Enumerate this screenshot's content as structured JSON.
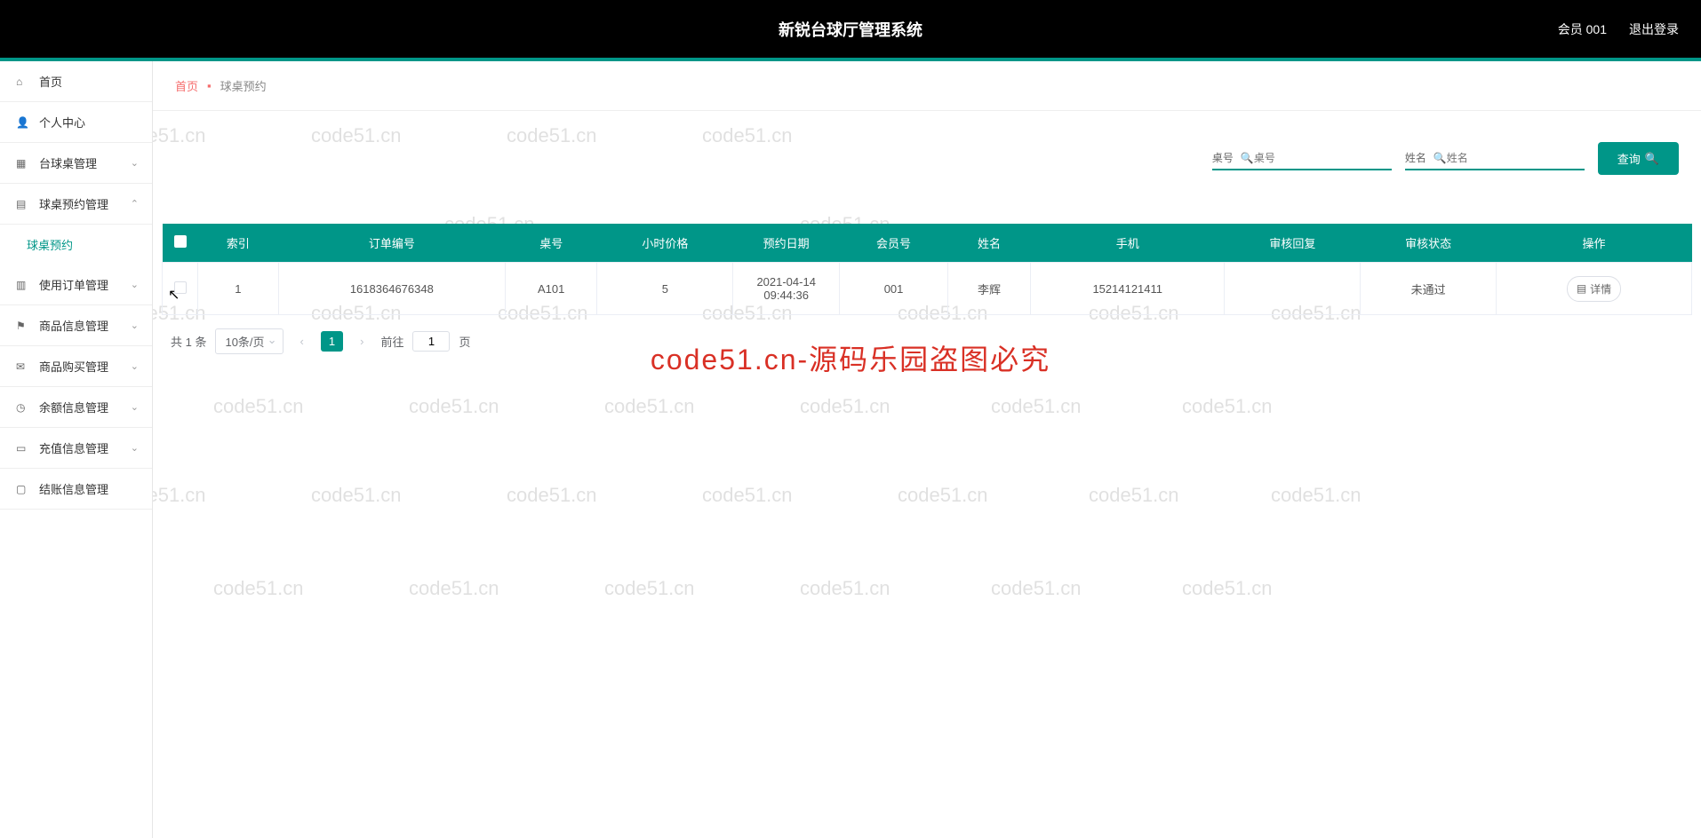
{
  "header": {
    "title": "新锐台球厅管理系统",
    "user_label": "会员 001",
    "logout_label": "退出登录"
  },
  "sidebar": {
    "items": [
      {
        "label": "首页",
        "icon": "⌂",
        "arrow": ""
      },
      {
        "label": "个人中心",
        "icon": "👤",
        "arrow": ""
      },
      {
        "label": "台球桌管理",
        "icon": "▦",
        "arrow": "⌄"
      },
      {
        "label": "球桌预约管理",
        "icon": "▤",
        "arrow": "⌃"
      },
      {
        "label": "球桌预约",
        "icon": "",
        "arrow": "",
        "submenu": true
      },
      {
        "label": "使用订单管理",
        "icon": "▥",
        "arrow": "⌄"
      },
      {
        "label": "商品信息管理",
        "icon": "⚑",
        "arrow": "⌄"
      },
      {
        "label": "商品购买管理",
        "icon": "✉",
        "arrow": "⌄"
      },
      {
        "label": "余额信息管理",
        "icon": "◷",
        "arrow": "⌄"
      },
      {
        "label": "充值信息管理",
        "icon": "▭",
        "arrow": "⌄"
      },
      {
        "label": "结账信息管理",
        "icon": "▢",
        "arrow": ""
      }
    ]
  },
  "breadcrumb": {
    "home": "首页",
    "current": "球桌预约"
  },
  "search": {
    "field1_label": "桌号",
    "field1_placeholder": "桌号",
    "field2_label": "姓名",
    "field2_placeholder": "姓名",
    "query_label": "查询"
  },
  "table": {
    "headers": [
      "索引",
      "订单编号",
      "桌号",
      "小时价格",
      "预约日期",
      "会员号",
      "姓名",
      "手机",
      "审核回复",
      "审核状态",
      "操作"
    ],
    "rows": [
      {
        "index": "1",
        "order_no": "1618364676348",
        "table_no": "A101",
        "hour_price": "5",
        "reserve_date": "2021-04-14 09:44:36",
        "member_no": "001",
        "name": "李辉",
        "phone": "15214121411",
        "review_reply": "",
        "review_status": "未通过",
        "action_label": "详情"
      }
    ]
  },
  "pagination": {
    "total_label": "共 1 条",
    "per_page": "10条/页",
    "current_page": "1",
    "goto_label": "前往",
    "goto_value": "1",
    "page_suffix": "页"
  },
  "watermark": {
    "main": "code51.cn-源码乐园盗图必究",
    "bg_text": "code51.cn"
  }
}
